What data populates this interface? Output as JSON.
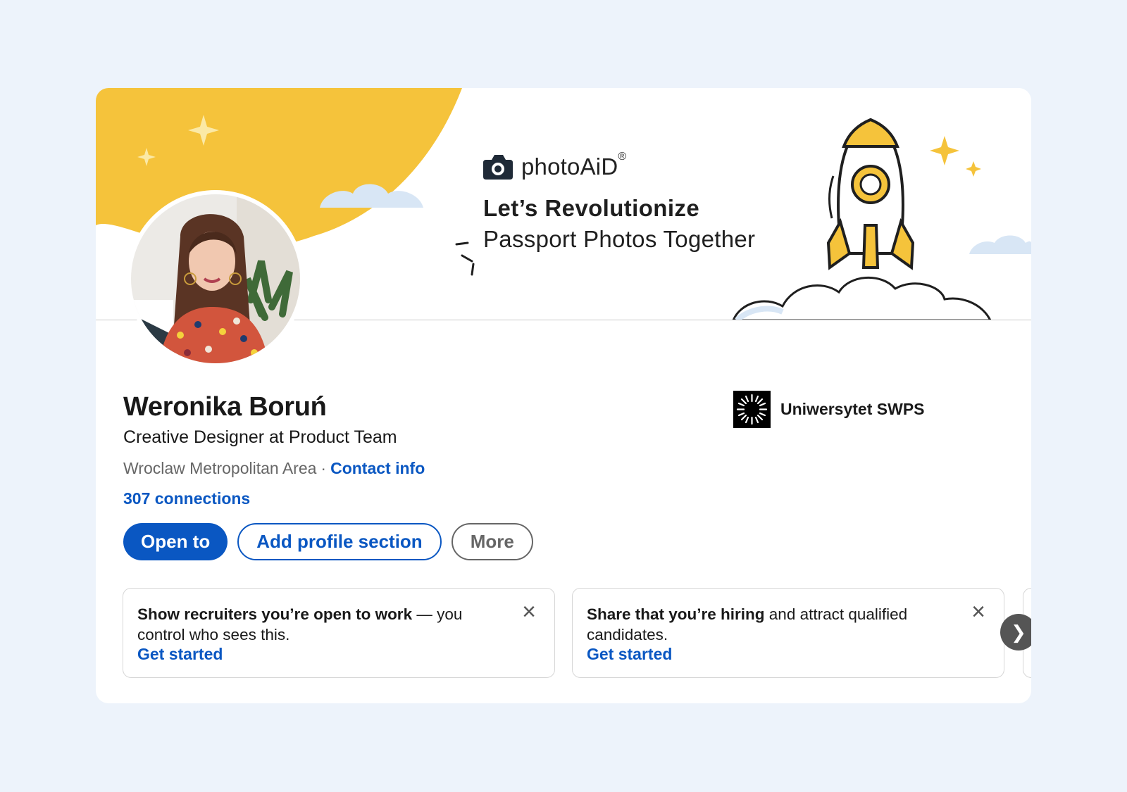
{
  "banner": {
    "brand_name": "photoAiD",
    "brand_mark": "®",
    "tagline_bold": "Let’s Revolutionize",
    "tagline_regular": "Passport Photos Together",
    "colors": {
      "sun": "#f5c33b",
      "cloud": "#d8e6f5",
      "rocket_accent": "#f5c33b"
    }
  },
  "profile": {
    "name": "Weronika Boruń",
    "headline": "Creative Designer at Product Team",
    "location": "Wroclaw Metropolitan Area",
    "separator": "·",
    "contact_info_label": "Contact info",
    "connections_label": "307 connections"
  },
  "school": {
    "name": "Uniwersytet SWPS",
    "logo_icon": "swps-logo-icon"
  },
  "actions": {
    "open_to_label": "Open to",
    "add_section_label": "Add profile section",
    "more_label": "More"
  },
  "suggestions": [
    {
      "bold": "Show recruiters you’re open to work",
      "rest": " — you control who sees this.",
      "cta": "Get started"
    },
    {
      "bold": "Share that you’re hiring",
      "rest": " and attract qualified candidates.",
      "cta": "Get started"
    }
  ],
  "icons": {
    "close": "×",
    "next": "❯"
  },
  "colors": {
    "primary": "#0a57c2",
    "background": "#edf3fb",
    "text": "#191919",
    "muted": "#666666"
  }
}
